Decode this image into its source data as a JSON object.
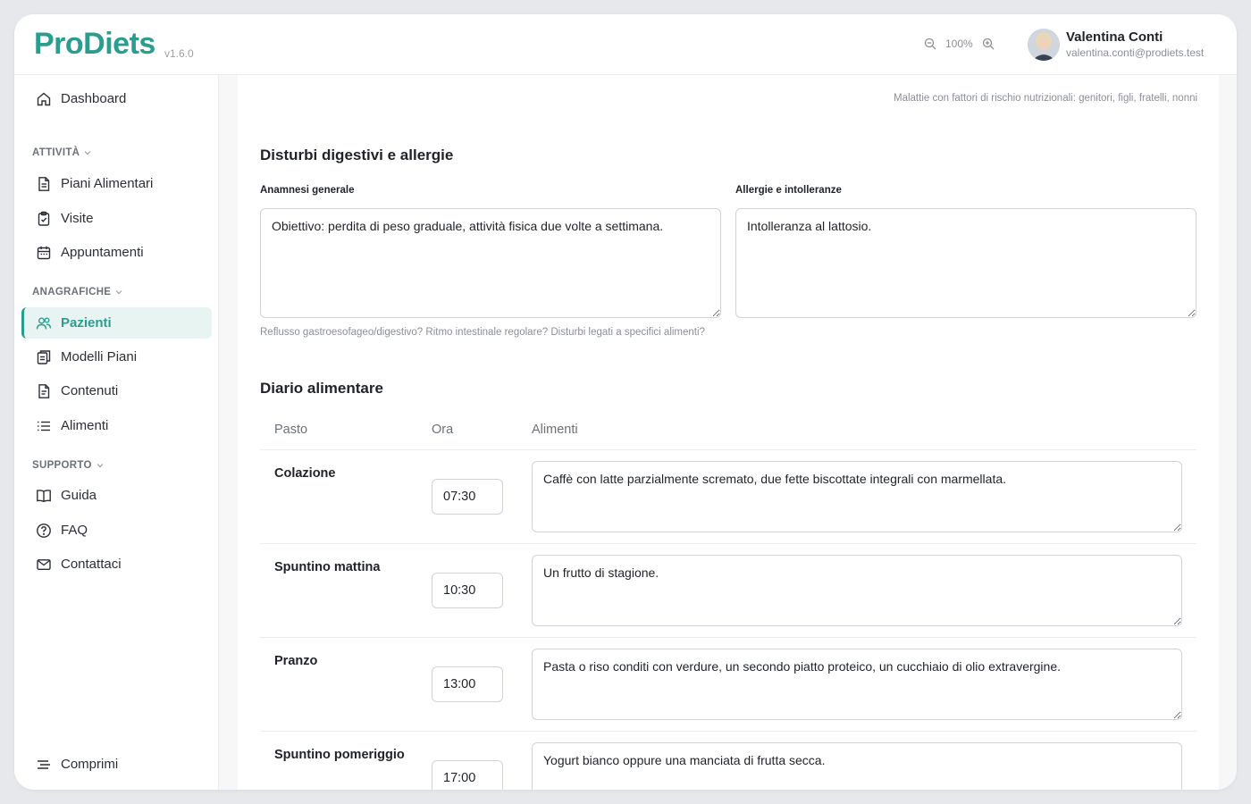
{
  "app": {
    "name": "ProDiets",
    "version": "v1.6.0"
  },
  "header": {
    "zoom_level": "100%",
    "user": {
      "name": "Valentina Conti",
      "email": "valentina.conti@prodiets.test"
    }
  },
  "sidebar": {
    "dashboard": "Dashboard",
    "sections": {
      "attivita": "ATTIVITÀ",
      "anagrafiche": "ANAGRAFICHE",
      "supporto": "SUPPORTO"
    },
    "items": {
      "piani_alimentari": "Piani Alimentari",
      "visite": "Visite",
      "appuntamenti": "Appuntamenti",
      "pazienti": "Pazienti",
      "modelli_piani": "Modelli Piani",
      "contenuti": "Contenuti",
      "alimenti": "Alimenti",
      "guida": "Guida",
      "faq": "FAQ",
      "contattaci": "Contattaci"
    },
    "collapse": "Comprimi",
    "active_item": "Pazienti"
  },
  "main": {
    "hint_top": "Malattie con fattori di rischio nutrizionali: genitori, figli, fratelli, nonni",
    "digestive": {
      "title": "Disturbi digestivi e allergie",
      "anamnesi_label": "Anamnesi generale",
      "anamnesi_value": "Obiettivo: perdita di peso graduale, attività fisica due volte a settimana.",
      "allergie_label": "Allergie e intolleranze",
      "allergie_value": "Intolleranza al lattosio.",
      "hint": "Reflusso gastroesofageo/digestivo? Ritmo intestinale regolare? Disturbi legati a specifici alimenti?"
    },
    "diary": {
      "title": "Diario alimentare",
      "columns": {
        "pasto": "Pasto",
        "ora": "Ora",
        "alimenti": "Alimenti"
      },
      "rows": [
        {
          "meal": "Colazione",
          "time": "07:30",
          "foods": "Caffè con latte parzialmente scremato, due fette biscottate integrali con marmellata."
        },
        {
          "meal": "Spuntino mattina",
          "time": "10:30",
          "foods": "Un frutto di stagione."
        },
        {
          "meal": "Pranzo",
          "time": "13:00",
          "foods": "Pasta o riso conditi con verdure, un secondo piatto proteico, un cucchiaio di olio extravergine."
        },
        {
          "meal": "Spuntino pomeriggio",
          "time": "17:00",
          "foods": "Yogurt bianco oppure una manciata di frutta secca."
        }
      ]
    }
  },
  "colors": {
    "brand": "#2a9d8f",
    "active_bg": "#e8f4f2"
  }
}
